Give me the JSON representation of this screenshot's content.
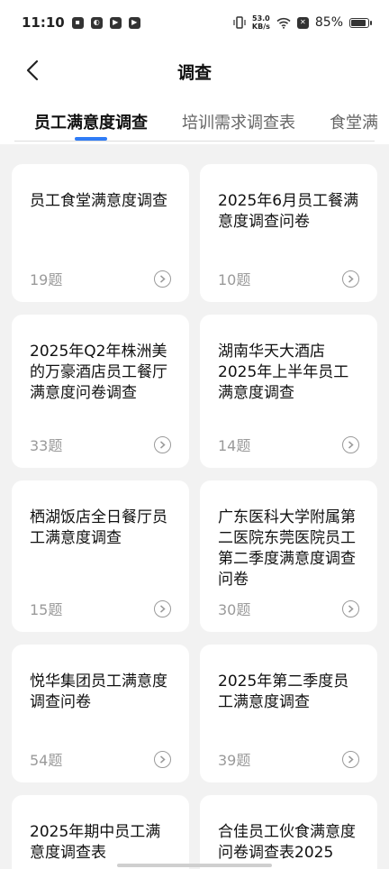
{
  "status_bar": {
    "time": "11:10",
    "speed_value": "53.0",
    "speed_unit": "KB/s",
    "battery_text": "85%"
  },
  "header": {
    "title": "调查",
    "tabs": [
      {
        "label": "员工满意度调查",
        "active": true
      },
      {
        "label": "培训需求调查表",
        "active": false
      },
      {
        "label": "食堂满",
        "active": false
      }
    ]
  },
  "cards": [
    {
      "title": "员工食堂满意度调查",
      "count": "19题"
    },
    {
      "title": "2025年6月员工餐满意度调查问卷",
      "count": "10题"
    },
    {
      "title": "2025年Q2年株洲美的万豪酒店员工餐厅满意度问卷调查",
      "count": "33题"
    },
    {
      "title": "湖南华天大酒店2025年上半年员工满意度调查",
      "count": "14题"
    },
    {
      "title": "栖湖饭店全日餐厅员工满意度调查",
      "count": "15题"
    },
    {
      "title": "广东医科大学附属第二医院东莞医院员工第二季度满意度调查问卷",
      "count": "30题"
    },
    {
      "title": "悦华集团员工满意度调查问卷",
      "count": "54题"
    },
    {
      "title": "2025年第二季度员工满意度调查",
      "count": "39题"
    },
    {
      "title": "2025年期中员工满意度调查表",
      "count": ""
    },
    {
      "title": "合佳员工伙食满意度问卷调查表2025",
      "count": ""
    }
  ]
}
